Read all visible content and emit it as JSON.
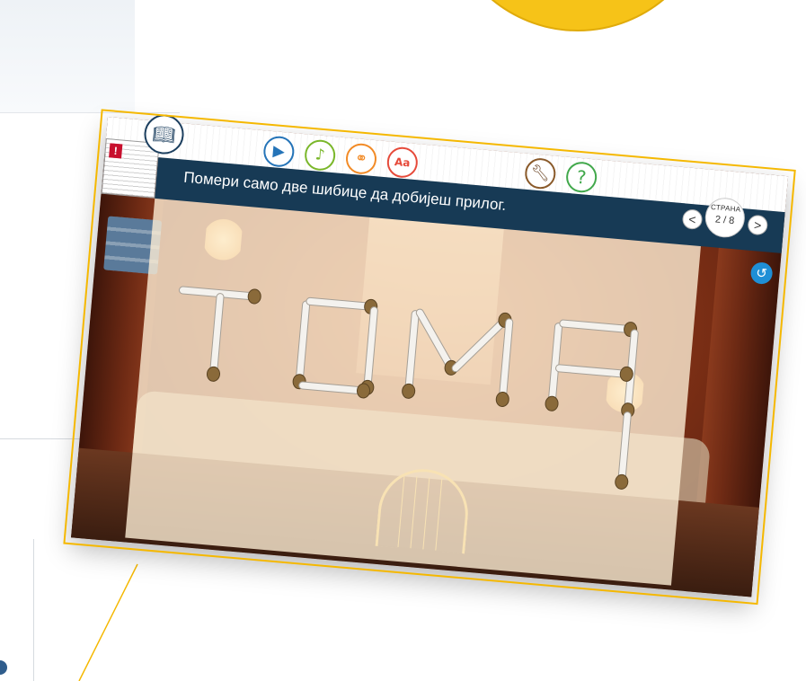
{
  "toolbar": {
    "book_icon": "book-icon",
    "video_icon": "play-icon",
    "music_icon": "music-note-icon",
    "link_icon": "chain-link-icon",
    "font_icon_label": "Aa",
    "tools_icon": "wrench-icon",
    "help_icon_label": "?",
    "warning_badge": "!"
  },
  "instruction": {
    "text": "Помери само две шибице да добијеш прилог."
  },
  "pager": {
    "label": "СТРАНА",
    "count": "2 / 8",
    "prev": "<",
    "next": ">"
  },
  "puzzle": {
    "word": "ТОМА"
  },
  "colors": {
    "instruction_bar": "#173a55",
    "highlight_outline": "#f5b800",
    "callout_disc": "#f6c318",
    "reset_button": "#1f8fd6"
  }
}
